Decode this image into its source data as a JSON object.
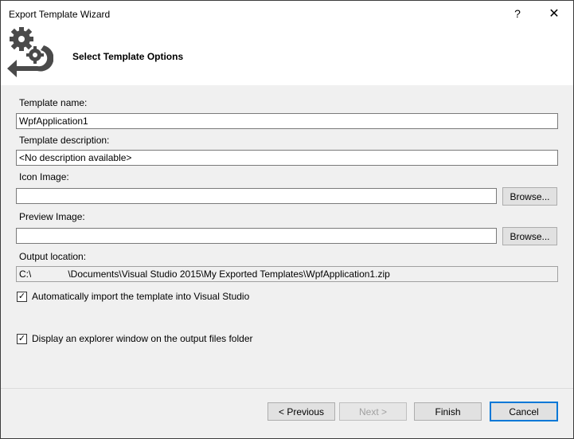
{
  "window": {
    "title": "Export Template Wizard",
    "help_glyph": "?",
    "close_glyph": "✕"
  },
  "header": {
    "title": "Select Template Options",
    "icon": "gears-export-icon"
  },
  "form": {
    "template_name_label": "Template name:",
    "template_name_value": "WpfApplication1",
    "template_description_label": "Template description:",
    "template_description_value": "<No description available>",
    "icon_image_label": "Icon Image:",
    "icon_image_value": "",
    "preview_image_label": "Preview Image:",
    "preview_image_value": "",
    "browse_label": "Browse...",
    "output_location_label": "Output location:",
    "output_location_prefix": "C:\\",
    "output_location_suffix": "\\Documents\\Visual Studio 2015\\My Exported Templates\\WpfApplication1.zip",
    "auto_import_label": "Automatically import the template into Visual Studio",
    "auto_import_checked": true,
    "explorer_label": "Display an explorer window on the output files folder",
    "explorer_checked": true,
    "check_glyph": "✓"
  },
  "buttons": {
    "previous": "< Previous",
    "next": "Next >",
    "finish": "Finish",
    "cancel": "Cancel"
  },
  "colors": {
    "accent": "#0078d7",
    "icon_gray": "#4a4a4a",
    "dialog_bg": "#f0f0f0"
  }
}
